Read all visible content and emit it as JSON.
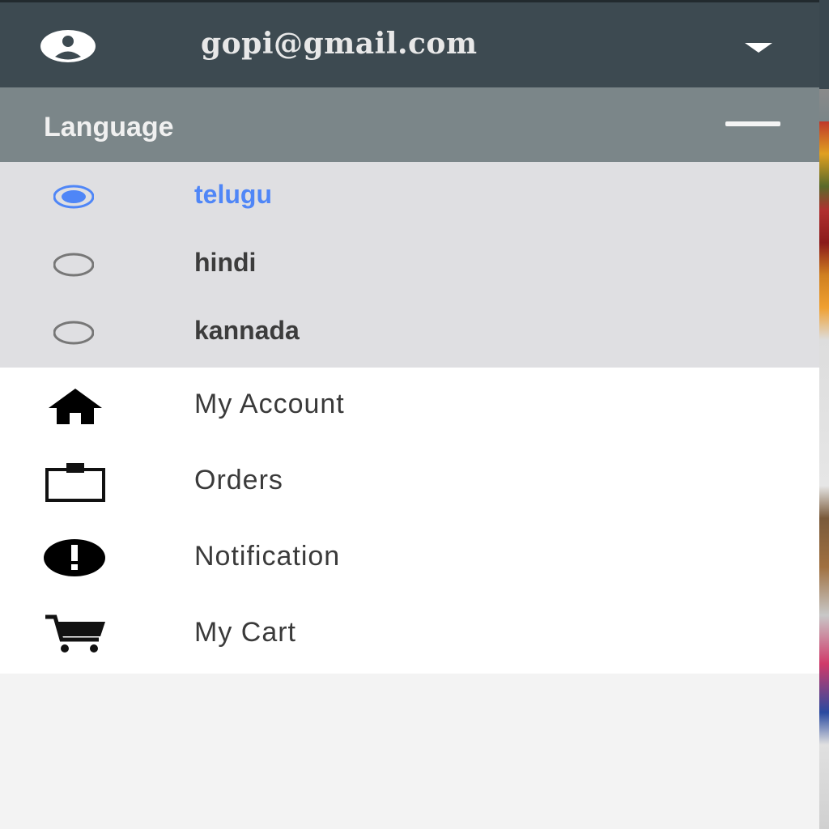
{
  "header": {
    "email": "gopi@gmail.com",
    "avatar_icon": "account-circle-icon",
    "dropdown_icon": "caret-down-icon",
    "background": "#3d4a51"
  },
  "language": {
    "title": "Language",
    "collapse_icon": "minus-icon",
    "header_background": "#7b8689",
    "options": [
      {
        "label": "telugu",
        "selected": true
      },
      {
        "label": "hindi",
        "selected": false
      },
      {
        "label": "kannada",
        "selected": false
      }
    ],
    "selected_color": "#4f86f7"
  },
  "menu": {
    "items": [
      {
        "label": "My Account",
        "icon": "home-icon"
      },
      {
        "label": "Orders",
        "icon": "clipboard-icon"
      },
      {
        "label": "Notification",
        "icon": "alert-circle-icon"
      },
      {
        "label": "My Cart",
        "icon": "cart-icon"
      }
    ]
  }
}
